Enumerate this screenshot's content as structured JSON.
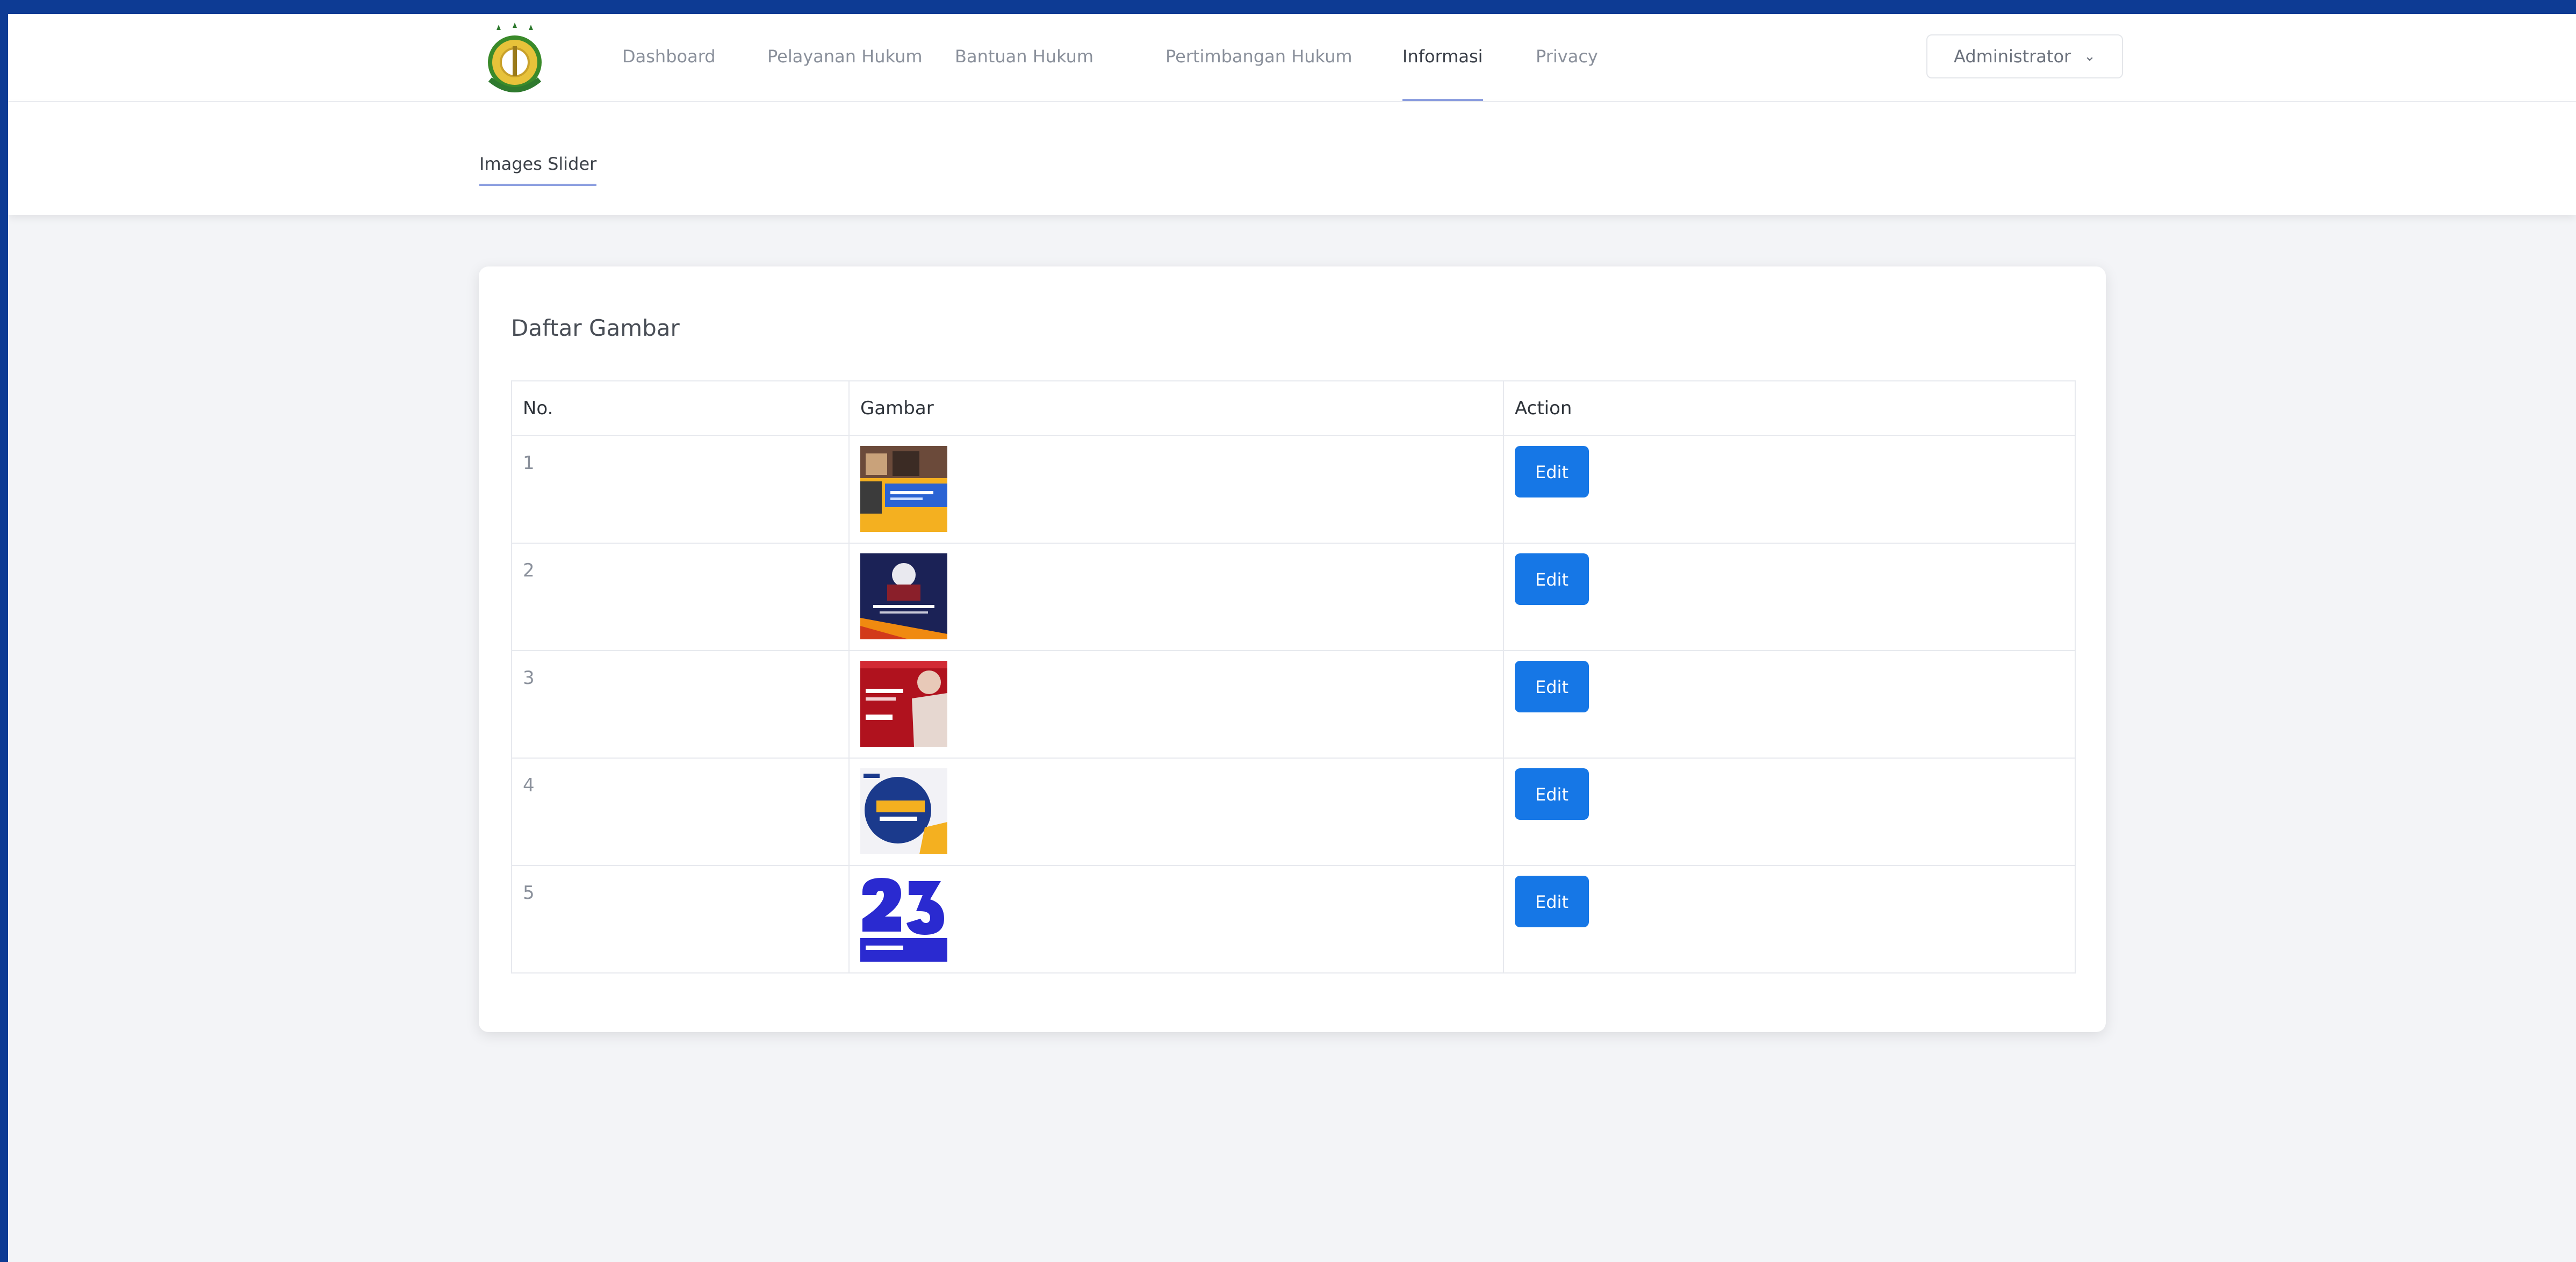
{
  "nav": {
    "items": [
      {
        "label": "Dashboard"
      },
      {
        "label": "Pelayanan Hukum"
      },
      {
        "label": "Bantuan Hukum"
      },
      {
        "label": "Pertimbangan Hukum"
      },
      {
        "label": "Informasi",
        "active": true
      },
      {
        "label": "Privacy"
      }
    ],
    "user": "Administrator"
  },
  "subnav": {
    "active": "Images Slider"
  },
  "card": {
    "title": "Daftar Gambar",
    "columns": [
      "No.",
      "Gambar",
      "Action"
    ],
    "rows": [
      {
        "no": "1",
        "thumb": "slider-image-1",
        "action": "Edit"
      },
      {
        "no": "2",
        "thumb": "slider-image-2",
        "action": "Edit"
      },
      {
        "no": "3",
        "thumb": "slider-image-3",
        "action": "Edit"
      },
      {
        "no": "4",
        "thumb": "slider-image-4",
        "action": "Edit"
      },
      {
        "no": "5",
        "thumb": "slider-image-5",
        "action": "Edit"
      }
    ]
  },
  "colors": {
    "border": "#0d3b94",
    "accent": "#1677e6",
    "underline": "#8d9fe0",
    "background": "#f3f4f7"
  }
}
